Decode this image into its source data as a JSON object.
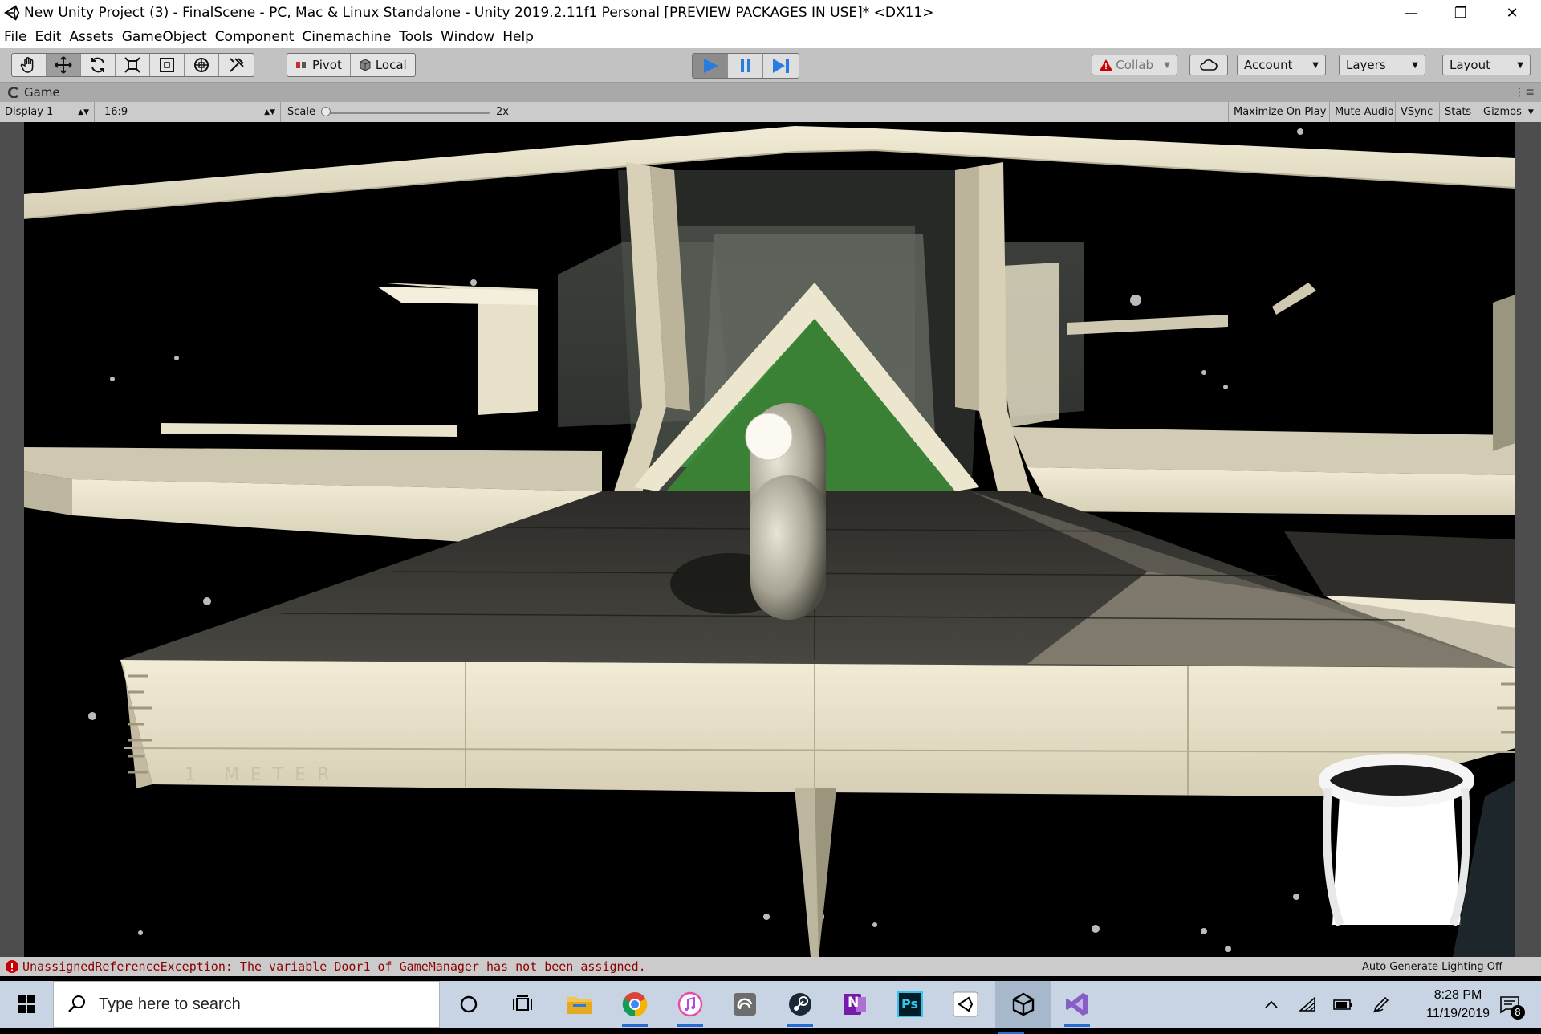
{
  "window": {
    "title": "New Unity Project (3) - FinalScene - PC, Mac & Linux Standalone - Unity 2019.2.11f1 Personal [PREVIEW PACKAGES IN USE]* <DX11>",
    "minimize": "—",
    "maximize": "❐",
    "close": "✕"
  },
  "menu": [
    "File",
    "Edit",
    "Assets",
    "GameObject",
    "Component",
    "Cinemachine",
    "Tools",
    "Window",
    "Help"
  ],
  "toolbar": {
    "pivot_label": "Pivot",
    "local_label": "Local",
    "collab_label": "Collab",
    "account_label": "Account",
    "layers_label": "Layers",
    "layout_label": "Layout"
  },
  "game_tab": {
    "label": "Game",
    "display": "Display 1",
    "aspect": "16:9",
    "scale_label": "Scale",
    "scale_value": "2x",
    "scale_position": 0.0,
    "maximize_on_play": "Maximize On Play",
    "mute_audio": "Mute Audio",
    "vsync": "VSync",
    "stats": "Stats",
    "gizmos": "Gizmos"
  },
  "status": {
    "error": "UnassignedReferenceException: The variable Door1 of GameManager has not been assigned.",
    "lighting": "Auto Generate Lighting Off"
  },
  "scene": {
    "floor_label": "1 METER"
  },
  "taskbar": {
    "search_placeholder": "Type here to search",
    "time": "8:28 PM",
    "date": "11/19/2019",
    "notification_count": "8",
    "photoshop_label": "Ps",
    "onenote_label": "N"
  },
  "colors": {
    "play_accent": "#2a7be0",
    "error": "#cc0000",
    "floor_green": "#3f8a3a",
    "structure_cream": "#e3dcc4",
    "walkway": "#3e3c37"
  }
}
